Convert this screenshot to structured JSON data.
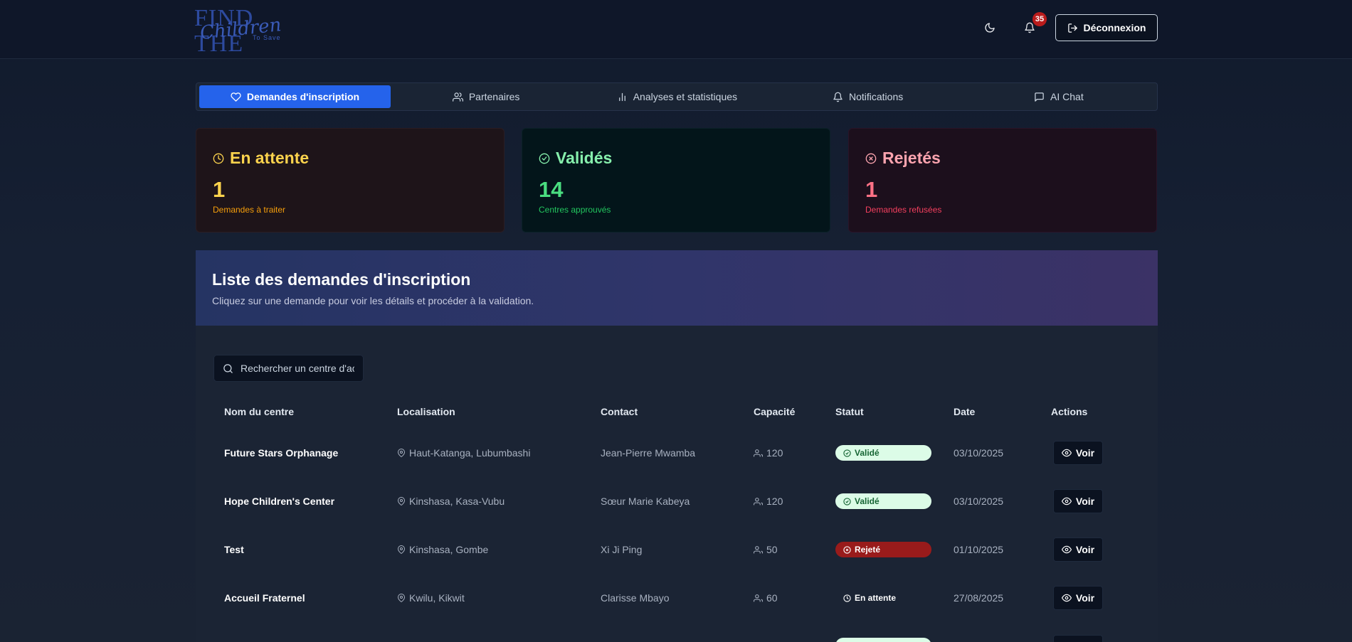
{
  "header": {
    "logo_main": "FIND THE",
    "logo_script": "Children",
    "logo_sub": "To Save",
    "notifications_count": "35",
    "logout_label": "Déconnexion"
  },
  "tabs": [
    {
      "label": "Demandes d'inscription",
      "icon": "heart-icon",
      "active": true
    },
    {
      "label": "Partenaires",
      "icon": "users-icon"
    },
    {
      "label": "Analyses et statistiques",
      "icon": "bar-chart-icon"
    },
    {
      "label": "Notifications",
      "icon": "bell-icon"
    },
    {
      "label": "AI Chat",
      "icon": "chat-icon"
    }
  ],
  "stats": {
    "pending": {
      "title": "En attente",
      "value": "1",
      "sub": "Demandes à traiter"
    },
    "valid": {
      "title": "Validés",
      "value": "14",
      "sub": "Centres approuvés"
    },
    "rejected": {
      "title": "Rejetés",
      "value": "1",
      "sub": "Demandes refusées"
    }
  },
  "list": {
    "title": "Liste des demandes d'inscription",
    "description": "Cliquez sur une demande pour voir les détails et procéder à la validation.",
    "search_placeholder": "Rechercher un centre d'ac",
    "columns": [
      "Nom du centre",
      "Localisation",
      "Contact",
      "Capacité",
      "Statut",
      "Date",
      "Actions"
    ],
    "action_label": "Voir",
    "rows": [
      {
        "name": "Future Stars Orphanage",
        "location": "Haut-Katanga, Lubumbashi",
        "contact": "Jean-Pierre Mwamba",
        "capacity": "120",
        "status": "Validé",
        "status_type": "valid",
        "date": "03/10/2025"
      },
      {
        "name": "Hope Children's Center",
        "location": "Kinshasa, Kasa-Vubu",
        "contact": "Sœur Marie Kabeya",
        "capacity": "120",
        "status": "Validé",
        "status_type": "valid",
        "date": "03/10/2025"
      },
      {
        "name": "Test",
        "location": "Kinshasa, Gombe",
        "contact": "Xi Ji Ping",
        "capacity": "50",
        "status": "Rejeté",
        "status_type": "rejected",
        "date": "01/10/2025"
      },
      {
        "name": "Accueil Fraternel",
        "location": "Kwilu, Kikwit",
        "contact": "Clarisse Mbayo",
        "capacity": "60",
        "status": "En attente",
        "status_type": "pending",
        "date": "27/08/2025"
      }
    ]
  },
  "colors": {
    "accent": "#2563eb",
    "pending": "#fcd34d",
    "valid": "#4ade80",
    "rejected": "#fb7185"
  }
}
